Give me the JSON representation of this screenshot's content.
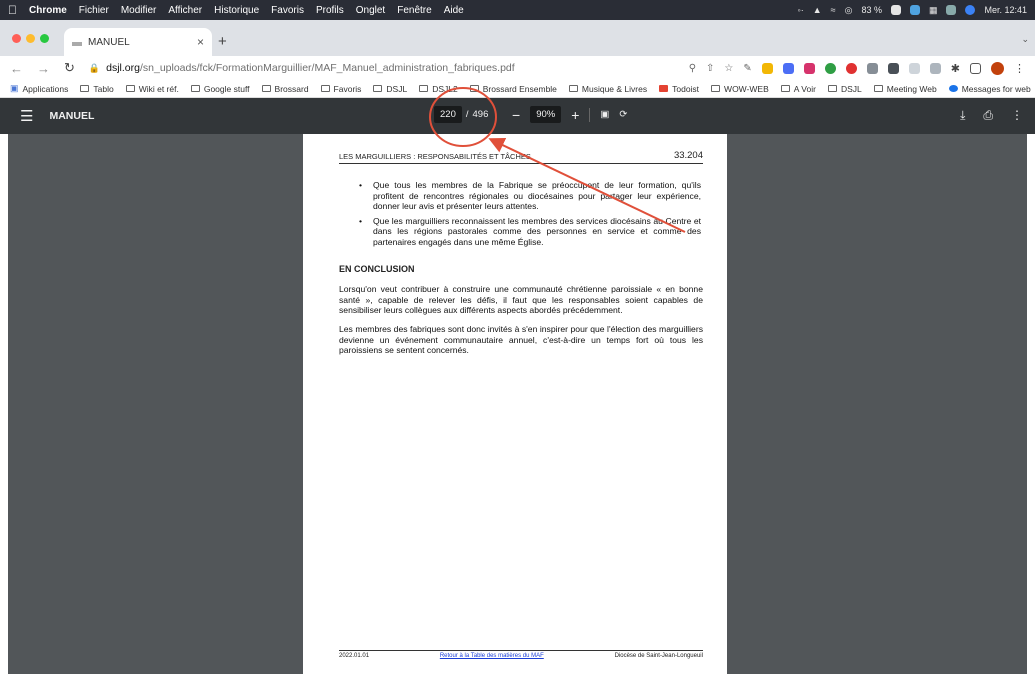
{
  "menubar": {
    "app": "Chrome",
    "items": [
      "Fichier",
      "Modifier",
      "Afficher",
      "Historique",
      "Favoris",
      "Profils",
      "Onglet",
      "Fenêtre",
      "Aide"
    ],
    "battery": "83 %",
    "clock": "Mer. 12:41"
  },
  "tab": {
    "title": "MANUEL",
    "close": "×",
    "new": "+"
  },
  "address": {
    "host": "dsjl.org",
    "path": "/sn_uploads/fck/FormationMarguillier/MAF_Manuel_administration_fabriques.pdf"
  },
  "bookmarks": [
    "Applications",
    "Tablo",
    "Wiki et réf.",
    "Google stuff",
    "Brossard",
    "Favoris",
    "DSJL",
    "DSJL2",
    "Brossard Ensemble",
    "Musique & Livres",
    "Todoist",
    "WOW-WEB",
    "A Voir",
    "DSJL",
    "Meeting Web",
    "Messages for web"
  ],
  "pdf": {
    "title": "MANUEL",
    "page_current": "220",
    "page_total": "496",
    "zoom": "90%"
  },
  "document": {
    "header_left": "LES MARGUILLIERS : RESPONSABILITÉS ET TÂCHES",
    "header_right": "33.204",
    "bullet1": "Que tous les membres de la Fabrique se préoccupent de leur formation, qu'ils profitent de rencontres régionales ou diocésaines pour partager leur expérience, donner leur avis et présenter leurs attentes.",
    "bullet2": "Que les marguilliers reconnaissent les membres des services diocésains au Centre et dans les régions pastorales comme des personnes en service et comme des partenaires engagés dans une même Église.",
    "heading": "EN CONCLUSION",
    "para1": "Lorsqu'on veut contribuer à construire une communauté chrétienne paroissiale « en bonne santé », capable de relever les défis, il faut que les responsables soient capables de sensibiliser leurs collègues aux différents aspects abordés précédemment.",
    "para2": "Les membres des fabriques sont donc invités à s'en inspirer pour que l'élection des marguilliers devienne un événement communautaire annuel, c'est-à-dire un temps fort où tous les paroissiens se sentent concernés.",
    "footer_date": "2022.01.01",
    "footer_link": "Retour à la Table des matières du MAF",
    "footer_right": "Diocèse de Saint-Jean-Longueuil"
  }
}
